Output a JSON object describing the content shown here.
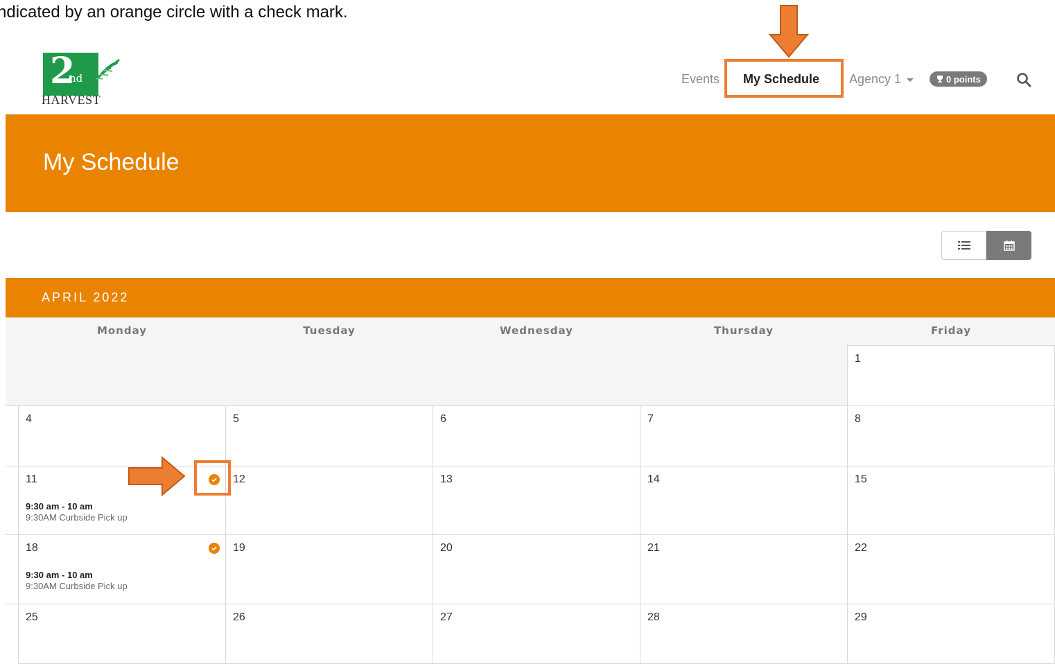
{
  "caption": "ndicated by an orange circle with a check mark.",
  "logo": {
    "number": "2",
    "suffix": "nd",
    "wordmark": "HARVEST"
  },
  "nav": {
    "events": "Events",
    "my_schedule": "My Schedule",
    "agency": "Agency 1",
    "points": "0 points"
  },
  "banner": {
    "title": "My Schedule"
  },
  "view_toggle": {
    "list_icon": "list-icon",
    "calendar_icon": "calendar-icon"
  },
  "calendar": {
    "month": "APRIL 2022",
    "weekdays": [
      "Monday",
      "Tuesday",
      "Wednesday",
      "Thursday",
      "Friday"
    ],
    "weeks": [
      [
        "",
        "",
        "",
        "",
        "1"
      ],
      [
        "4",
        "5",
        "6",
        "7",
        "8"
      ],
      [
        "11",
        "12",
        "13",
        "14",
        "15"
      ],
      [
        "18",
        "19",
        "20",
        "21",
        "22"
      ],
      [
        "25",
        "26",
        "27",
        "28",
        "29"
      ]
    ],
    "events": [
      {
        "day": "11",
        "time": "9:30 am - 10 am",
        "title": "9:30AM Curbside Pick up"
      },
      {
        "day": "18",
        "time": "9:30 am - 10 am",
        "title": "9:30AM Curbside Pick up"
      }
    ]
  },
  "colors": {
    "accent": "#e98300",
    "highlight": "#ed7d31",
    "logo_green": "#1f9a4a"
  }
}
